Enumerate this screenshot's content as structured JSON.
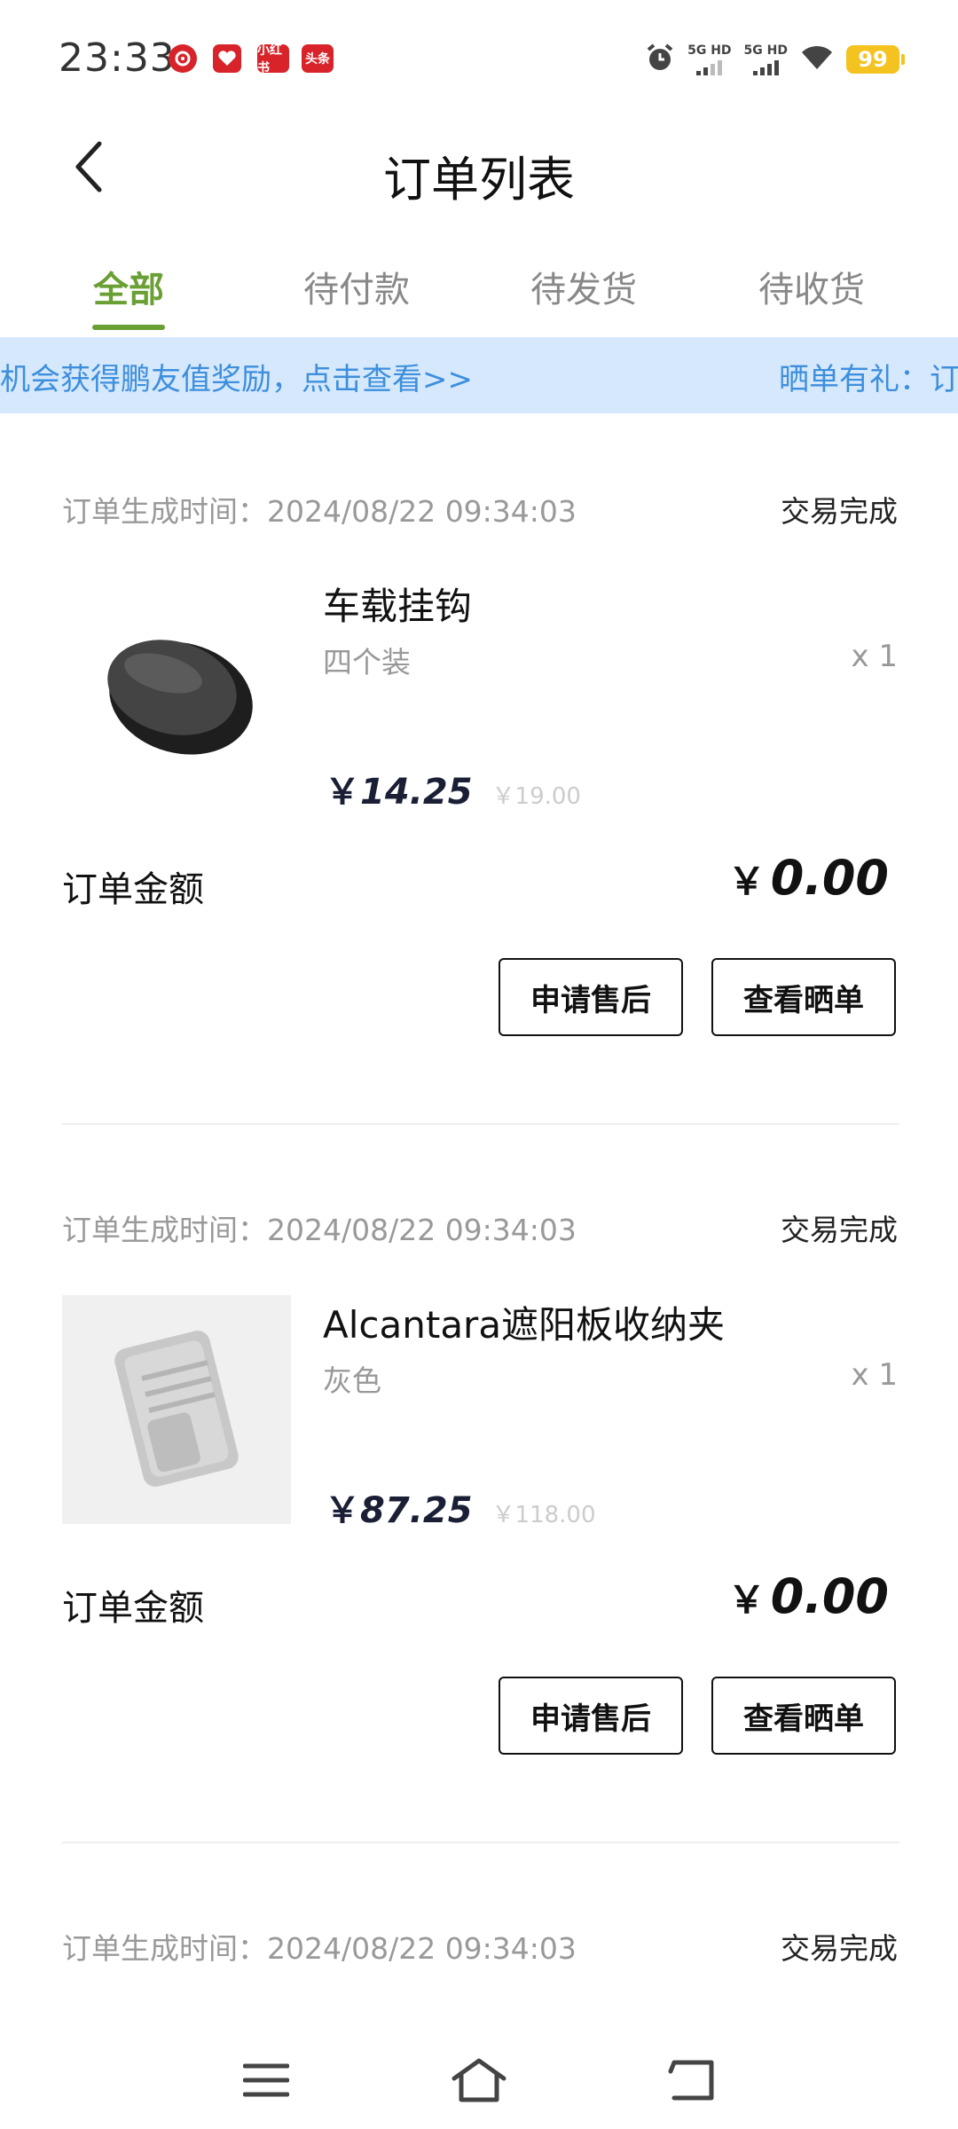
{
  "status_bar": {
    "time": "23:33",
    "notifications": [
      "netease-music-icon",
      "heart-app-icon",
      "xiaohongshu-icon",
      "toutiao-icon"
    ],
    "notif_labels": {
      "xhs": "小红书",
      "toutiao": "头条"
    },
    "signal1_label": "5G HD",
    "signal2_label": "5G HD",
    "battery": "99"
  },
  "header": {
    "title": "订单列表"
  },
  "tabs": [
    {
      "label": "全部",
      "active": true
    },
    {
      "label": "待付款"
    },
    {
      "label": "待发货"
    },
    {
      "label": "待收货"
    }
  ],
  "banner": {
    "text1": "机会获得鹏友值奖励，点击查看>>",
    "text2": "晒单有礼：订"
  },
  "orders": [
    {
      "time_label": "订单生成时间：2024/08/22 09:34:03",
      "status": "交易完成",
      "product_name": "车载挂钩",
      "spec": "四个装",
      "qty": "x 1",
      "currency": "￥",
      "price": "14.25",
      "original_price": "￥19.00",
      "amount_label": "订单金额",
      "amount": "0.00",
      "buttons": {
        "after_sale": "申请售后",
        "review": "查看晒单"
      }
    },
    {
      "time_label": "订单生成时间：2024/08/22 09:34:03",
      "status": "交易完成",
      "product_name": "Alcantara遮阳板收纳夹",
      "spec": "灰色",
      "qty": "x 1",
      "currency": "￥",
      "price": "87.25",
      "original_price": "￥118.00",
      "amount_label": "订单金额",
      "amount": "0.00",
      "buttons": {
        "after_sale": "申请售后",
        "review": "查看晒单"
      }
    },
    {
      "time_label": "订单生成时间：2024/08/22 09:34:03",
      "status": "交易完成"
    }
  ],
  "colors": {
    "accent": "#6a9f34",
    "banner_bg": "#d6e8fb",
    "banner_text": "#3d8fdd"
  },
  "navbar": {
    "icons": [
      "menu-icon",
      "home-icon",
      "back-nav-icon"
    ]
  }
}
